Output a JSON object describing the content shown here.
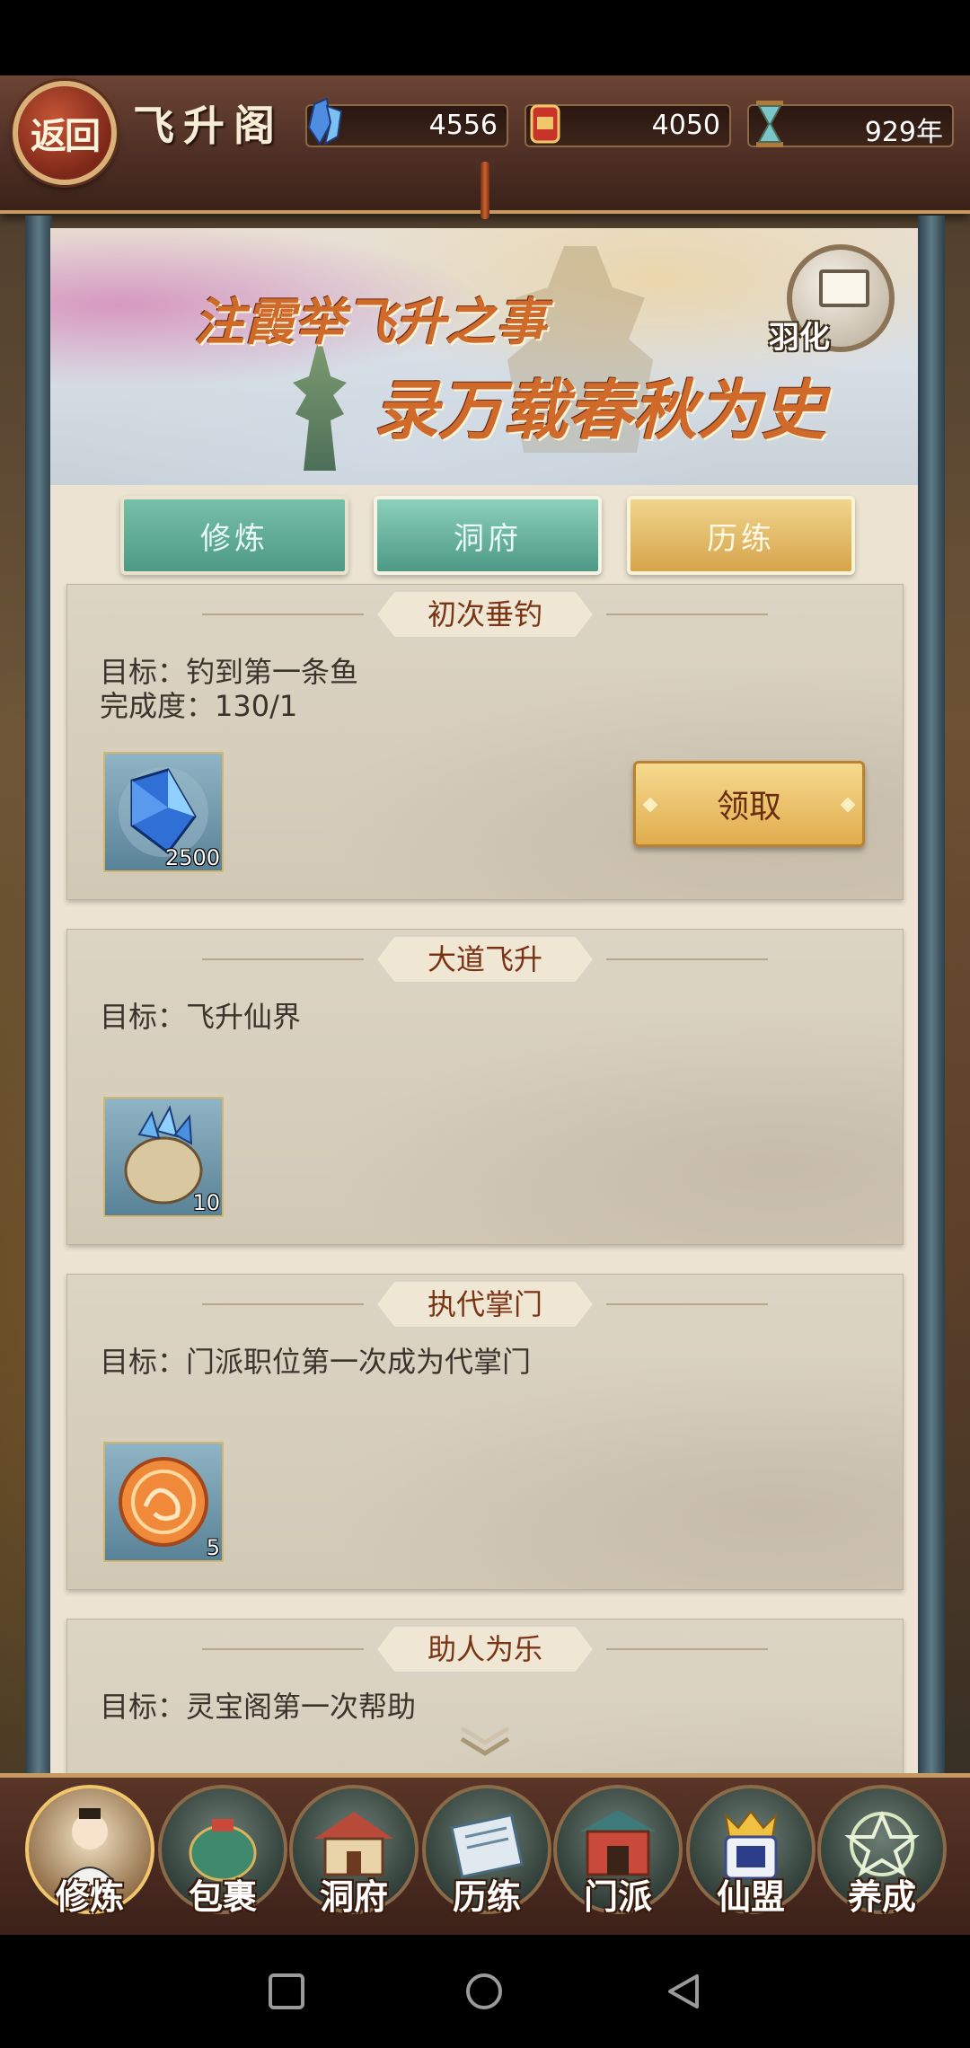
{
  "header": {
    "back_label": "返回",
    "title": "飞升阁",
    "resources": [
      {
        "icon": "crystal-icon",
        "value": "4556"
      },
      {
        "icon": "treasure-bag-icon",
        "value": "4050"
      },
      {
        "icon": "hourglass-icon",
        "value": "929年"
      }
    ]
  },
  "banner": {
    "line1": "注霞举飞升之事",
    "line2": "录万载春秋为史",
    "yuhua_label": "羽化"
  },
  "tabs": [
    {
      "label": "修炼",
      "state": "normal"
    },
    {
      "label": "洞府",
      "state": "normal"
    },
    {
      "label": "历练",
      "state": "active"
    }
  ],
  "achievements": [
    {
      "title": "初次垂钓",
      "goal": "目标：钓到第一条鱼",
      "progress": "完成度：130/1",
      "reward_icon": "spirit-crystal-icon",
      "reward_count": "2500",
      "claim_label": "领取"
    },
    {
      "title": "大道飞升",
      "goal": "目标：飞升仙界",
      "progress": "",
      "reward_icon": "crystal-pouch-icon",
      "reward_count": "10"
    },
    {
      "title": "执代掌门",
      "goal": "目标：门派职位第一次成为代掌门",
      "progress": "",
      "reward_icon": "dragon-token-icon",
      "reward_count": "5"
    },
    {
      "title": "助人为乐",
      "goal": "目标：灵宝阁第一次帮助",
      "progress": ""
    }
  ],
  "bottom_nav": [
    {
      "label": "修炼",
      "icon": "cultivator-avatar-icon"
    },
    {
      "label": "包裹",
      "icon": "bag-icon"
    },
    {
      "label": "洞府",
      "icon": "cave-mansion-icon"
    },
    {
      "label": "历练",
      "icon": "scroll-icon"
    },
    {
      "label": "门派",
      "icon": "sect-gate-icon"
    },
    {
      "label": "仙盟",
      "icon": "alliance-icon"
    },
    {
      "label": "养成",
      "icon": "pentagram-icon"
    }
  ],
  "colors": {
    "accent_gold": "#e0ad4e",
    "tab_teal": "#4e9a86",
    "title_brown": "#7a3414"
  }
}
